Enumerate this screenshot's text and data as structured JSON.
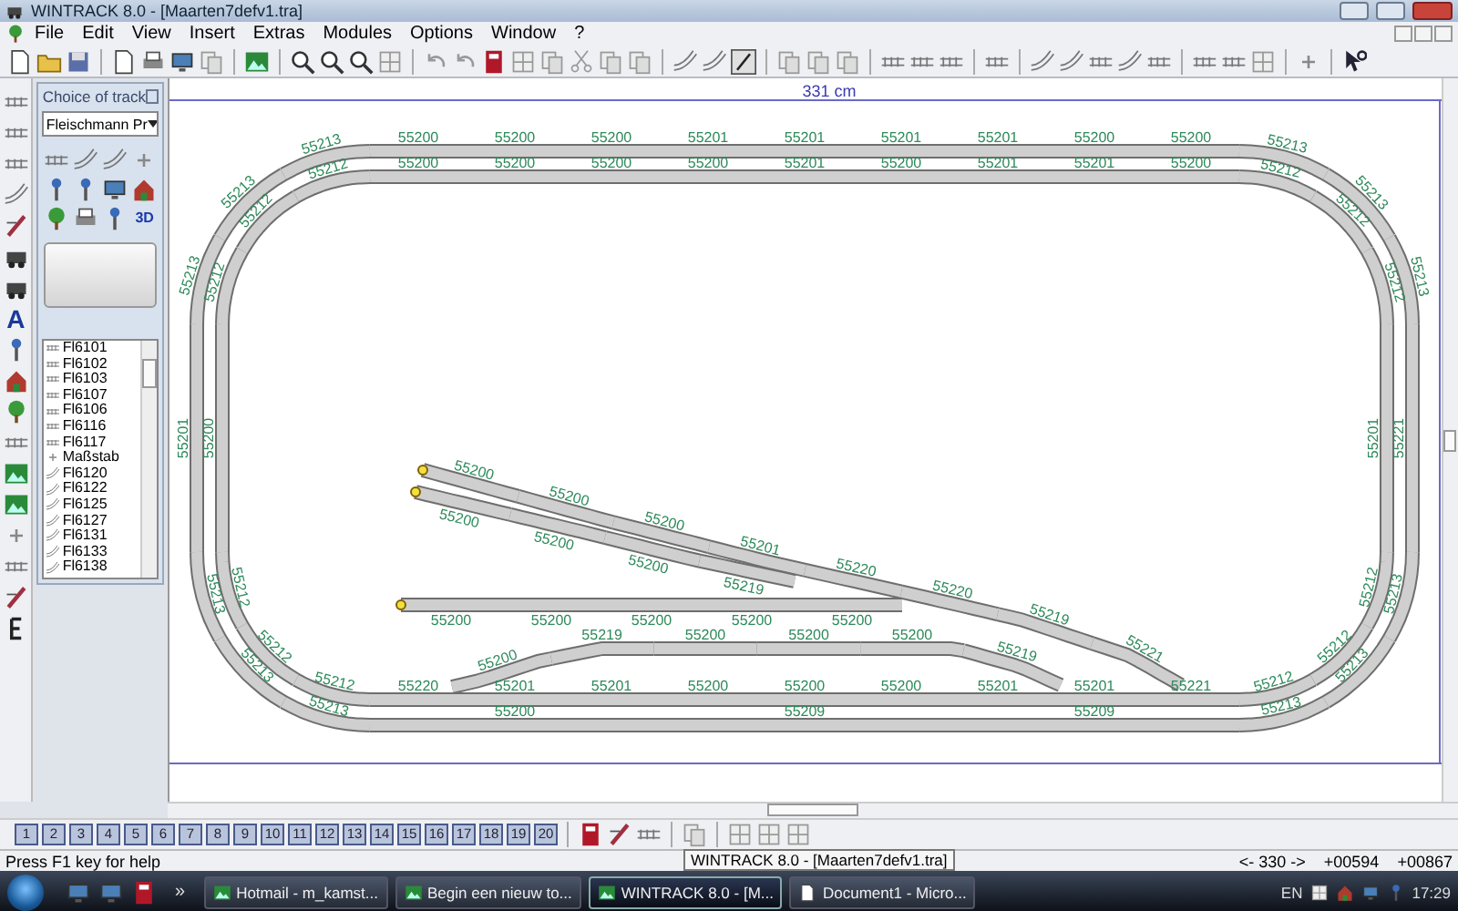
{
  "window": {
    "title": "WINTRACK 8.0 - [Maarten7defv1.tra]"
  },
  "menu": [
    "File",
    "Edit",
    "View",
    "Insert",
    "Extras",
    "Modules",
    "Options",
    "Window",
    "?"
  ],
  "left_toolbar": {
    "text_tool": "A"
  },
  "track_panel": {
    "title": "Choice of track",
    "manufacturer": "Fleischmann Pr",
    "view_3d": "3D",
    "items": [
      {
        "label": "Fl6101",
        "kind": "straight"
      },
      {
        "label": "Fl6102",
        "kind": "straight"
      },
      {
        "label": "Fl6103",
        "kind": "straight"
      },
      {
        "label": "Fl6107",
        "kind": "straight"
      },
      {
        "label": "Fl6106",
        "kind": "straight"
      },
      {
        "label": "Fl6116",
        "kind": "straight"
      },
      {
        "label": "Fl6117",
        "kind": "straight"
      },
      {
        "label": "Maßstab",
        "kind": "scale"
      },
      {
        "label": "Fl6120",
        "kind": "curve"
      },
      {
        "label": "Fl6122",
        "kind": "curve"
      },
      {
        "label": "Fl6125",
        "kind": "curve"
      },
      {
        "label": "Fl6127",
        "kind": "curve"
      },
      {
        "label": "Fl6131",
        "kind": "curve"
      },
      {
        "label": "Fl6133",
        "kind": "curve"
      },
      {
        "label": "Fl6138",
        "kind": "curve"
      }
    ]
  },
  "canvas": {
    "ruler_label": "331 cm",
    "tracks": [
      {
        "kind": "loop",
        "labels": [
          "55200",
          "55200",
          "55200",
          "55201",
          "55201",
          "55201",
          "55201",
          "55200",
          "55200"
        ]
      },
      {
        "kind": "loop",
        "labels": [
          "55200",
          "55200",
          "55200",
          "55200",
          "55201",
          "55200",
          "55201",
          "55201",
          "55200"
        ]
      },
      {
        "kind": "loop",
        "labels": [
          "55213",
          "55213",
          "55213"
        ]
      },
      {
        "kind": "loop",
        "labels": [
          "55212",
          "55212",
          "55212"
        ]
      },
      {
        "kind": "loop",
        "labels": [
          "55213",
          "55213",
          "55213"
        ]
      },
      {
        "kind": "loop",
        "labels": [
          "55212",
          "55212",
          "55212"
        ]
      },
      {
        "kind": "loop",
        "labels": [
          "55201"
        ]
      },
      {
        "kind": "loop",
        "labels": [
          "55200"
        ]
      },
      {
        "kind": "loop",
        "labels": [
          "55221"
        ]
      },
      {
        "kind": "loop",
        "labels": [
          "55201"
        ]
      },
      {
        "kind": "siding",
        "labels": [
          "55200",
          "55200",
          "55200",
          "55201",
          "55220",
          "55220",
          "55219",
          "55221"
        ]
      },
      {
        "kind": "branch",
        "labels": [
          "55200",
          "55200",
          "55200",
          "55219"
        ]
      },
      {
        "kind": "spur",
        "labels": [
          "55200",
          "55200",
          "55200",
          "55200",
          "55200"
        ]
      },
      {
        "kind": "loop",
        "labels": [
          "55200",
          "55219",
          "55200",
          "55200",
          "55200",
          "55219"
        ]
      },
      {
        "kind": "loop",
        "labels": [
          "55213",
          "55213",
          "55213"
        ]
      },
      {
        "kind": "loop",
        "labels": [
          "55212",
          "55212",
          "55212"
        ]
      },
      {
        "kind": "loop",
        "labels": [
          "55213",
          "55213",
          "55213"
        ]
      },
      {
        "kind": "loop",
        "labels": [
          "55212",
          "55212",
          "55212"
        ]
      },
      {
        "kind": "loop",
        "labels": [
          "55220",
          "55201",
          "55201",
          "55200",
          "55200",
          "55200",
          "55201",
          "55201",
          "55221"
        ]
      },
      {
        "kind": "loop",
        "labels": [
          "55200",
          "55209",
          "55209"
        ]
      }
    ]
  },
  "page_tabs": [
    {
      "label": "1",
      "selected": false
    },
    {
      "label": "2",
      "selected": false
    },
    {
      "label": "3",
      "selected": false
    },
    {
      "label": "4",
      "selected": false
    },
    {
      "label": "5",
      "selected": false
    },
    {
      "label": "6",
      "selected": false
    },
    {
      "label": "7",
      "selected": false
    },
    {
      "label": "8",
      "selected": false
    },
    {
      "label": "9",
      "selected": false
    },
    {
      "label": "10",
      "selected": false
    },
    {
      "label": "11",
      "selected": false
    },
    {
      "label": "12",
      "selected": false
    },
    {
      "label": "13",
      "selected": false
    },
    {
      "label": "14",
      "selected": false
    },
    {
      "label": "15",
      "selected": false
    },
    {
      "label": "16",
      "selected": false
    },
    {
      "label": "17",
      "selected": false
    },
    {
      "label": "18",
      "selected": false
    },
    {
      "label": "19",
      "selected": false
    },
    {
      "label": "20",
      "selected": false
    }
  ],
  "status_bar": {
    "help": "Press F1 key for help",
    "width": "<- 330 ->",
    "x": "+00594",
    "y": "+00867"
  },
  "tooltip": "WINTRACK 8.0 - [Maarten7defv1.tra]",
  "taskbar": {
    "overflow": "»",
    "tasks": [
      {
        "label": "Hotmail - m_kamst...",
        "selected": false
      },
      {
        "label": "Begin een nieuw to...",
        "selected": false
      },
      {
        "label": "WINTRACK 8.0 - [M...",
        "selected": true
      },
      {
        "label": "Document1 - Micro...",
        "selected": false
      }
    ],
    "language": "EN",
    "clock": "17:29"
  }
}
